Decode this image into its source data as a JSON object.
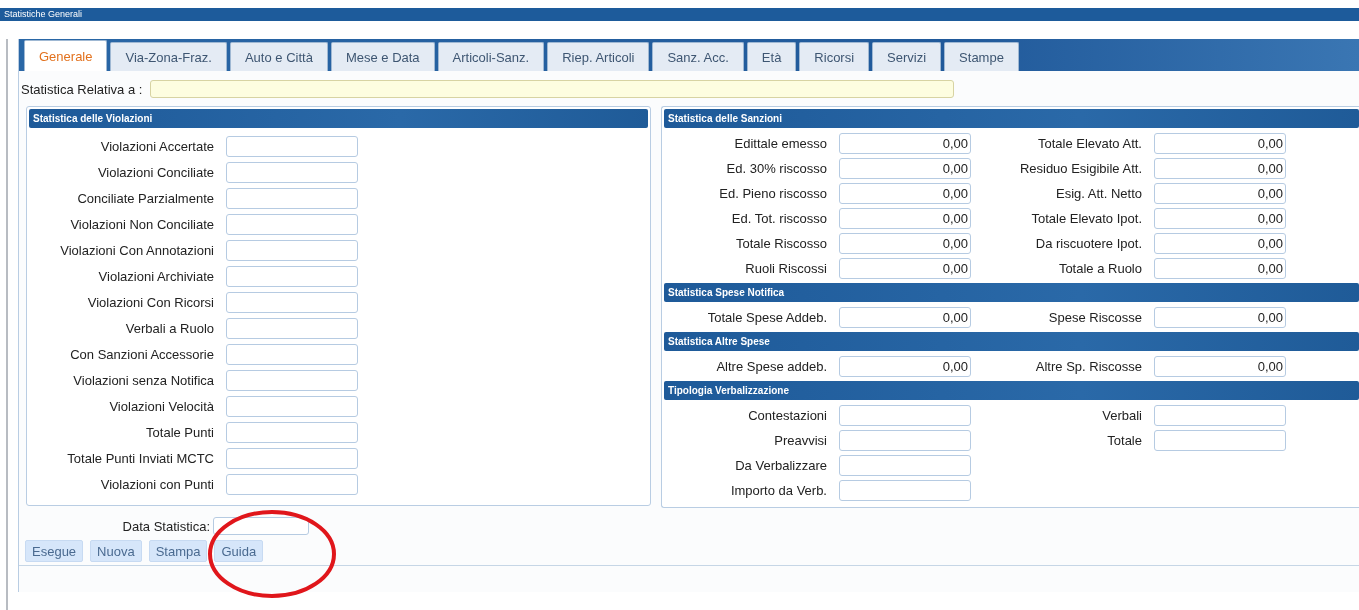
{
  "window": {
    "title": "Statistiche Generali"
  },
  "tabs": [
    {
      "label": "Generale",
      "selected": true
    },
    {
      "label": "Via-Zona-Fraz.",
      "selected": false
    },
    {
      "label": "Auto e Città",
      "selected": false
    },
    {
      "label": "Mese e Data",
      "selected": false
    },
    {
      "label": "Articoli-Sanz.",
      "selected": false
    },
    {
      "label": "Riep. Articoli",
      "selected": false
    },
    {
      "label": "Sanz. Acc.",
      "selected": false
    },
    {
      "label": "Età",
      "selected": false
    },
    {
      "label": "Ricorsi",
      "selected": false
    },
    {
      "label": "Servizi",
      "selected": false
    },
    {
      "label": "Stampe",
      "selected": false
    }
  ],
  "relative_label": "Statistica Relativa a :",
  "violations": {
    "title": "Statistica delle Violazioni",
    "fields": [
      "Violazioni Accertate",
      "Violazioni Conciliate",
      "Conciliate Parzialmente",
      "Violazioni Non Conciliate",
      "Violazioni Con Annotazioni",
      "Violazioni Archiviate",
      "Violazioni Con Ricorsi",
      "Verbali a Ruolo",
      "Con Sanzioni Accessorie",
      "Violazioni senza Notifica",
      "Violazioni Velocità",
      "Totale Punti",
      "Totale Punti Inviati MCTC",
      "Violazioni con Punti"
    ]
  },
  "sections": [
    {
      "title": "Statistica delle Sanzioni",
      "left": [
        {
          "label": "Edittale emesso",
          "value": "0,00"
        },
        {
          "label": "Ed. 30% riscosso",
          "value": "0,00"
        },
        {
          "label": "Ed. Pieno riscosso",
          "value": "0,00"
        },
        {
          "label": "Ed. Tot. riscosso",
          "value": "0,00"
        },
        {
          "label": "Totale Riscosso",
          "value": "0,00"
        },
        {
          "label": "Ruoli Riscossi",
          "value": "0,00"
        }
      ],
      "right": [
        {
          "label": "Totale Elevato Att.",
          "value": "0,00"
        },
        {
          "label": "Residuo Esigibile Att.",
          "value": "0,00"
        },
        {
          "label": "Esig. Att. Netto",
          "value": "0,00"
        },
        {
          "label": "Totale Elevato Ipot.",
          "value": "0,00"
        },
        {
          "label": "Da riscuotere Ipot.",
          "value": "0,00"
        },
        {
          "label": "Totale a Ruolo",
          "value": "0,00"
        }
      ]
    },
    {
      "title": "Statistica Spese Notifica",
      "left": [
        {
          "label": "Totale Spese Addeb.",
          "value": "0,00"
        }
      ],
      "right": [
        {
          "label": "Spese Riscosse",
          "value": "0,00"
        }
      ]
    },
    {
      "title": "Statistica Altre Spese",
      "left": [
        {
          "label": "Altre Spese addeb.",
          "value": "0,00"
        }
      ],
      "right": [
        {
          "label": "Altre Sp. Riscosse",
          "value": "0,00"
        }
      ]
    },
    {
      "title": "Tipologia Verbalizzazione",
      "left": [
        {
          "label": "Contestazioni"
        },
        {
          "label": "Preavvisi"
        },
        {
          "label": "Da Verbalizzare"
        },
        {
          "label": "Importo da Verb."
        }
      ],
      "right": [
        {
          "label": "Verbali"
        },
        {
          "label": "Totale"
        }
      ]
    }
  ],
  "date_label": "Data Statistica:",
  "buttons": [
    "Esegue",
    "Nuova",
    "Stampa",
    "Guida"
  ]
}
